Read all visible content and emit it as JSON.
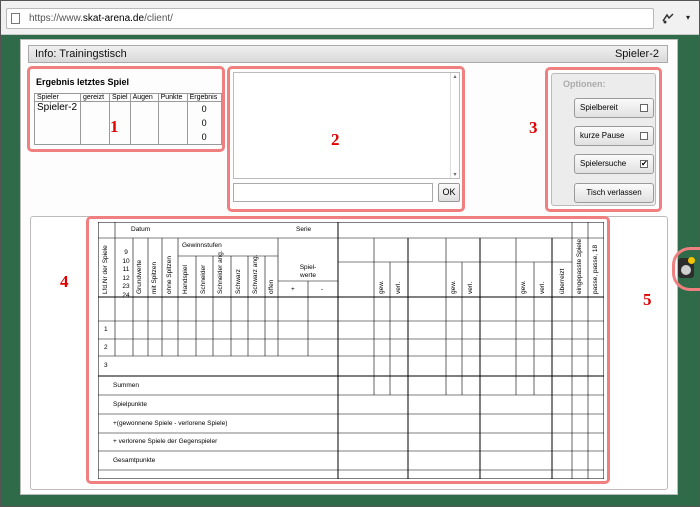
{
  "browser": {
    "url_prefix": "https://www.",
    "url_domain": "skat-arena.de",
    "url_path": "/client/",
    "menu_glyph": "▾"
  },
  "info_bar": {
    "left": "Info: Trainingstisch",
    "right": "Spieler-2"
  },
  "result": {
    "title": "Ergebnis letztes Spiel",
    "columns": [
      "Spieler",
      "gereizt",
      "Spiel",
      "Augen",
      "Punkte",
      "Ergebnis"
    ],
    "player": "Spieler-2",
    "results": [
      "0",
      "0",
      "0"
    ]
  },
  "chat": {
    "ok_label": "OK",
    "scroll_up": "▴",
    "scroll_down": "▾"
  },
  "options": {
    "label": "Optionen:",
    "buttons": [
      {
        "label": "Spielbereit",
        "checked": false
      },
      {
        "label": "kurze Pause",
        "checked": false
      },
      {
        "label": "Spielersuche",
        "checked": true
      }
    ],
    "leave_label": "Tisch verlassen",
    "check_glyph": "✔"
  },
  "sheet": {
    "datum": "Datum",
    "serie": "Serie",
    "col_lfd": "Lfd.Nr der Spiele",
    "reizwerte": [
      "9",
      "10",
      "11",
      "12",
      "23",
      "24"
    ],
    "col_grundwerte": "Grundwerte",
    "col_mit": "mit Spitzen",
    "col_ohne": "ohne Spitzen",
    "gewinnstufen": "Gewinnstufen",
    "stufen": [
      "Handspiel",
      "Schneider",
      "Schneider ang.",
      "Schwarz",
      "Schwarz ang.",
      "offen"
    ],
    "spielwerte": "Spiel-\nwerte",
    "plus": "+",
    "minus": "-",
    "gew": "gew.",
    "verl": "verl.",
    "ueberreizt": "überreizt",
    "eingepasste": "eingepasste Spiele",
    "passe": "passe, passe, 18",
    "rows": [
      "1",
      "2",
      "3"
    ],
    "summary": [
      "Summen",
      "Spielpunkte",
      "+(gewonnene Spiele - verlorene Spiele)",
      "+ verlorene Spiele der Gegenspieler",
      "Gesamtpunkte"
    ]
  },
  "annotations": [
    "1",
    "2",
    "3",
    "4",
    "5"
  ],
  "colors": {
    "background_green": "#2f6a49",
    "highlight": "#f08080",
    "annotation_red": "#e00000"
  }
}
